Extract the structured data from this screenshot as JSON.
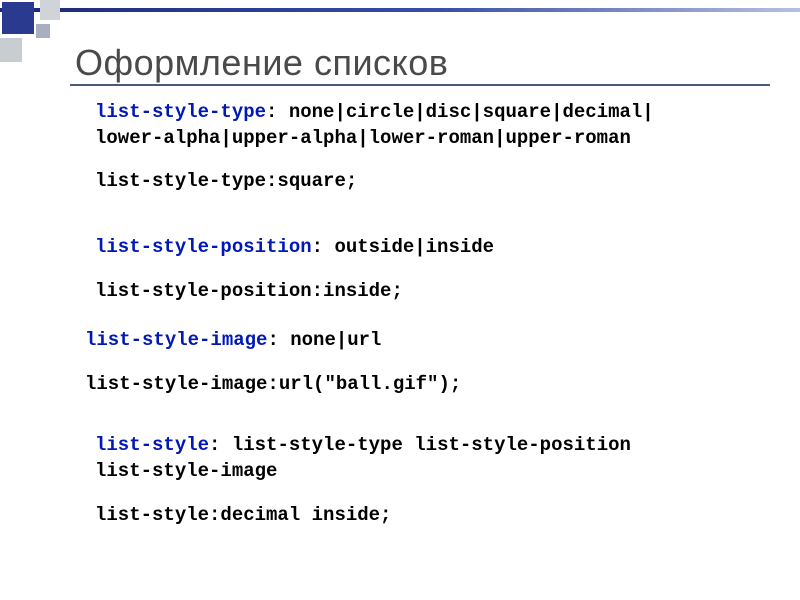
{
  "title": "Оформление списков",
  "blocks": {
    "type": {
      "prop": "list-style-type",
      "values": ": none|circle|disc|square|decimal|",
      "values2": "lower-alpha|upper-alpha|lower-roman|upper-roman",
      "example": "list-style-type:square;"
    },
    "position": {
      "prop": "list-style-position",
      "values": ": outside|inside",
      "example": "list-style-position:inside;"
    },
    "image": {
      "prop": "list-style-image",
      "values": ": none|url",
      "example": "list-style-image:url(\"ball.gif\");"
    },
    "shorthand": {
      "prop": "list-style",
      "values": ": list-style-type list-style-position",
      "values2": "list-style-image",
      "example": "list-style:decimal inside;"
    }
  }
}
